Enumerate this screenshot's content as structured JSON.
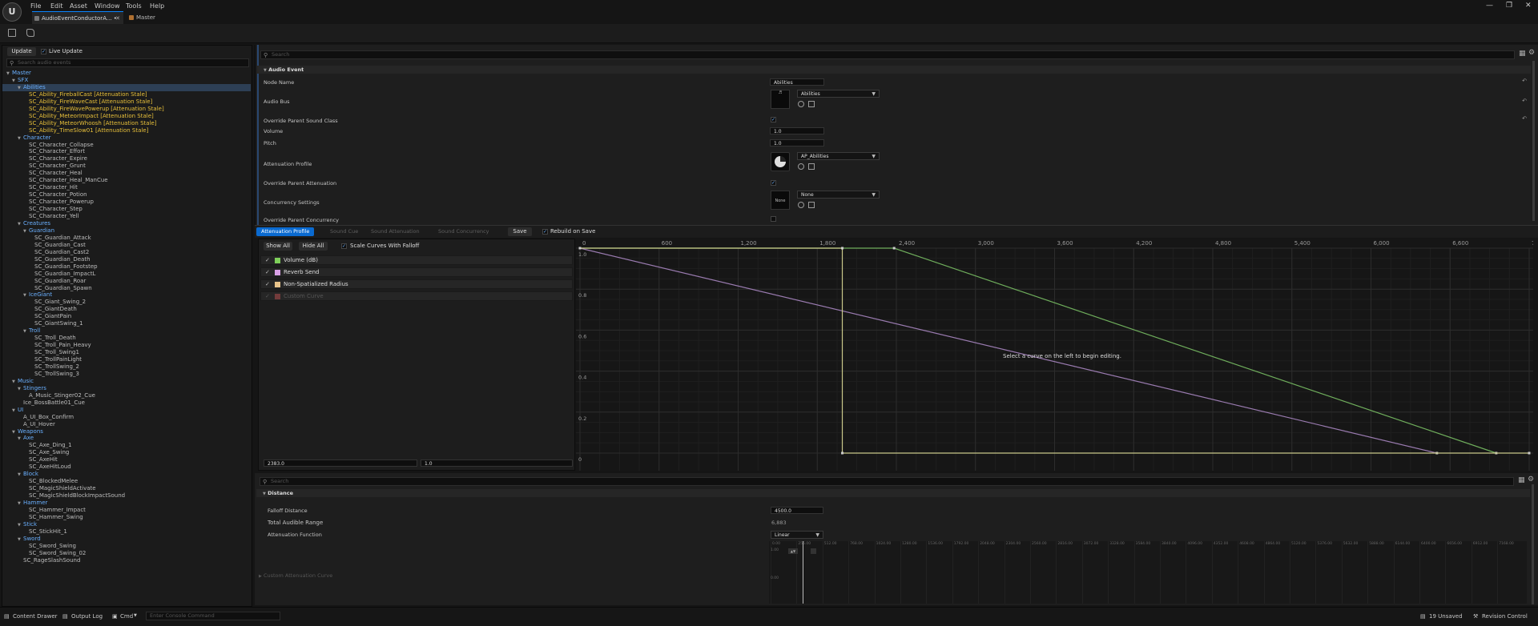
{
  "menu": [
    "File",
    "Edit",
    "Asset",
    "Window",
    "Tools",
    "Help"
  ],
  "tabs": [
    "AudioEventConductorA... •",
    "Master"
  ],
  "left": {
    "update_label": "Update",
    "live_update_label": "Live Update",
    "search_placeholder": "Search audio events",
    "tree": [
      {
        "t": "Master",
        "d": 0,
        "k": "cat",
        "a": "▼"
      },
      {
        "t": "SFX",
        "d": 1,
        "k": "cat",
        "a": "▼"
      },
      {
        "t": "Abilities",
        "d": 2,
        "k": "cat sel",
        "a": "▼"
      },
      {
        "t": "SC_Ability_FireballCast [Attenuation Stale]",
        "d": 3,
        "k": "stale"
      },
      {
        "t": "SC_Ability_FireWaveCast [Attenuation Stale]",
        "d": 3,
        "k": "stale"
      },
      {
        "t": "SC_Ability_FireWavePowerup [Attenuation Stale]",
        "d": 3,
        "k": "stale"
      },
      {
        "t": "SC_Ability_MeteorImpact [Attenuation Stale]",
        "d": 3,
        "k": "stale"
      },
      {
        "t": "SC_Ability_MeteorWhoosh [Attenuation Stale]",
        "d": 3,
        "k": "stale"
      },
      {
        "t": "SC_Ability_TimeSlow01 [Attenuation Stale]",
        "d": 3,
        "k": "stale"
      },
      {
        "t": "Character",
        "d": 2,
        "k": "cat",
        "a": "▼"
      },
      {
        "t": "SC_Character_Collapse",
        "d": 3
      },
      {
        "t": "SC_Character_Effort",
        "d": 3
      },
      {
        "t": "SC_Character_Expire",
        "d": 3
      },
      {
        "t": "SC_Character_Grunt",
        "d": 3
      },
      {
        "t": "SC_Character_Heal",
        "d": 3
      },
      {
        "t": "SC_Character_Heal_ManCue",
        "d": 3
      },
      {
        "t": "SC_Character_Hit",
        "d": 3
      },
      {
        "t": "SC_Character_Potion",
        "d": 3
      },
      {
        "t": "SC_Character_Powerup",
        "d": 3
      },
      {
        "t": "SC_Character_Step",
        "d": 3
      },
      {
        "t": "SC_Character_Yell",
        "d": 3
      },
      {
        "t": "Creatures",
        "d": 2,
        "k": "cat",
        "a": "▼"
      },
      {
        "t": "Guardian",
        "d": 3,
        "k": "cat",
        "a": "▼"
      },
      {
        "t": "SC_Guardian_Attack",
        "d": 4
      },
      {
        "t": "SC_Guardian_Cast",
        "d": 4
      },
      {
        "t": "SC_Guardian_Cast2",
        "d": 4
      },
      {
        "t": "SC_Guardian_Death",
        "d": 4
      },
      {
        "t": "SC_Guardian_Footstep",
        "d": 4
      },
      {
        "t": "SC_Guardian_ImpactL",
        "d": 4
      },
      {
        "t": "SC_Guardian_Roar",
        "d": 4
      },
      {
        "t": "SC_Guardian_Spawn",
        "d": 4
      },
      {
        "t": "IceGiant",
        "d": 3,
        "k": "cat",
        "a": "▼"
      },
      {
        "t": "SC_Giant_Swing_2",
        "d": 4
      },
      {
        "t": "SC_GiantDeath",
        "d": 4
      },
      {
        "t": "SC_GiantPain",
        "d": 4
      },
      {
        "t": "SC_GiantSwing_1",
        "d": 4
      },
      {
        "t": "Troll",
        "d": 3,
        "k": "cat",
        "a": "▼"
      },
      {
        "t": "SC_Troll_Death",
        "d": 4
      },
      {
        "t": "SC_Troll_Pain_Heavy",
        "d": 4
      },
      {
        "t": "SC_Troll_Swing1",
        "d": 4
      },
      {
        "t": "SC_TrollPainLight",
        "d": 4
      },
      {
        "t": "SC_TrollSwing_2",
        "d": 4
      },
      {
        "t": "SC_TrollSwing_3",
        "d": 4
      },
      {
        "t": "Music",
        "d": 1,
        "k": "cat",
        "a": "▼"
      },
      {
        "t": "Stingers",
        "d": 2,
        "k": "cat",
        "a": "▼"
      },
      {
        "t": "A_Music_Stinger02_Cue",
        "d": 3
      },
      {
        "t": "Ice_BossBattle01_Cue",
        "d": 2
      },
      {
        "t": "UI",
        "d": 1,
        "k": "cat",
        "a": "▼"
      },
      {
        "t": "A_UI_Box_Confirm",
        "d": 2
      },
      {
        "t": "A_UI_Hover",
        "d": 2
      },
      {
        "t": "Weapons",
        "d": 1,
        "k": "cat",
        "a": "▼"
      },
      {
        "t": "Axe",
        "d": 2,
        "k": "cat",
        "a": "▼"
      },
      {
        "t": "SC_Axe_Ding_1",
        "d": 3
      },
      {
        "t": "SC_Axe_Swing",
        "d": 3
      },
      {
        "t": "SC_AxeHit",
        "d": 3
      },
      {
        "t": "SC_AxeHitLoud",
        "d": 3
      },
      {
        "t": "Block",
        "d": 2,
        "k": "cat",
        "a": "▼"
      },
      {
        "t": "SC_BlockedMelee",
        "d": 3
      },
      {
        "t": "SC_MagicShieldActivate",
        "d": 3
      },
      {
        "t": "SC_MagicShieldBlockImpactSound",
        "d": 3
      },
      {
        "t": "Hammer",
        "d": 2,
        "k": "cat",
        "a": "▼"
      },
      {
        "t": "SC_Hammer_Impact",
        "d": 3
      },
      {
        "t": "SC_Hammer_Swing",
        "d": 3
      },
      {
        "t": "Stick",
        "d": 2,
        "k": "cat",
        "a": "▼"
      },
      {
        "t": "SC_StickHit_1",
        "d": 3
      },
      {
        "t": "Sword",
        "d": 2,
        "k": "cat",
        "a": "▼"
      },
      {
        "t": "SC_Sword_Swing",
        "d": 3
      },
      {
        "t": "SC_Sword_Swing_02",
        "d": 3
      },
      {
        "t": "SC_RageSlashSound",
        "d": 2
      }
    ]
  },
  "details": {
    "search_placeholder": "Search",
    "section": "Audio Event",
    "node_name_label": "Node Name",
    "node_name": "Abilities",
    "audio_bus_label": "Audio Bus",
    "audio_bus": "Abilities",
    "override_sound_class_label": "Override Parent Sound Class",
    "volume_label": "Volume",
    "volume": "1.0",
    "pitch_label": "Pitch",
    "pitch": "1.0",
    "attenuation_label": "Attenuation Profile",
    "attenuation": "AP_Abilities",
    "override_attenuation_label": "Override Parent Attenuation",
    "concurrency_label": "Concurrency Settings",
    "concurrency": "None",
    "concurrency_thumb": "None",
    "override_concurrency_label": "Override Parent Concurrency"
  },
  "curve_tabs": {
    "active": "Attenuation Profile",
    "others": [
      "Sound Cue",
      "Sound Attenuation",
      "Sound Concurrency"
    ],
    "save": "Save",
    "rebuild": "Rebuild on Save"
  },
  "curve_left": {
    "show_all": "Show All",
    "hide_all": "Hide All",
    "scale_label": "Scale Curves With Falloff",
    "curves": [
      {
        "name": "Volume (dB)",
        "color": "#7ecf5a",
        "dim": false
      },
      {
        "name": "Reverb Send",
        "color": "#d9a0e6",
        "dim": false
      },
      {
        "name": "Non-Spatialized Radius",
        "color": "#e8c38a",
        "dim": false
      },
      {
        "name": "Custom Curve",
        "color": "#c05050",
        "dim": true
      }
    ],
    "key_time": "2383.0",
    "key_value": "1.0"
  },
  "chart_data": {
    "type": "line",
    "xlim": [
      0,
      7200
    ],
    "ylim": [
      0,
      1.0
    ],
    "x_ticks": [
      "0",
      "600",
      "1,200",
      "1,800",
      "2,400",
      "3,000",
      "3,600",
      "4,200",
      "4,800",
      "5,400",
      "6,000",
      "6,600",
      "7,200"
    ],
    "y_ticks": [
      "1.0",
      "0.8",
      "0.6",
      "0.4",
      "0.2",
      "0"
    ],
    "annotation": "Select a curve on the left to begin editing.",
    "series": [
      {
        "name": "Volume (dB)",
        "color": "#6fae5c",
        "points": [
          [
            0,
            1.0
          ],
          [
            2383,
            1.0
          ],
          [
            6950,
            0
          ]
        ]
      },
      {
        "name": "Reverb Send",
        "color": "#9a7bb0",
        "points": [
          [
            0,
            1.0
          ],
          [
            6500,
            0
          ]
        ]
      },
      {
        "name": "Non-Spatialized Radius",
        "color": "#c9c88a",
        "points": [
          [
            0,
            1.0
          ],
          [
            1990,
            1.0
          ],
          [
            1990,
            0
          ],
          [
            7200,
            0
          ]
        ]
      }
    ]
  },
  "lower": {
    "search_placeholder": "Search",
    "section": "Distance",
    "falloff_label": "Falloff Distance",
    "falloff": "4500.0",
    "total_label": "Total Audible Range",
    "total": "6,883",
    "function_label": "Attenuation Function",
    "function": "Linear",
    "custom_label": "Custom Attenuation Curve",
    "mini_ticks": [
      "0.00",
      "256.00",
      "512.00",
      "768.00",
      "1024.00",
      "1280.00",
      "1536.00",
      "1792.00",
      "2048.00",
      "2304.00",
      "2560.00",
      "2816.00",
      "3072.00",
      "3328.00",
      "3584.00",
      "3840.00",
      "4096.00",
      "4352.00",
      "4608.00",
      "4864.00",
      "5120.00",
      "5376.00",
      "5632.00",
      "5888.00",
      "6144.00",
      "6400.00",
      "6656.00",
      "6912.00",
      "7168.00"
    ],
    "mini_y_top": "1.00",
    "mini_y_bot": "0.00"
  },
  "status": {
    "content_drawer": "Content Drawer",
    "output_log": "Output Log",
    "cmd": "Cmd",
    "console_placeholder": "Enter Console Command",
    "unsaved": "19 Unsaved",
    "revision": "Revision Control"
  }
}
